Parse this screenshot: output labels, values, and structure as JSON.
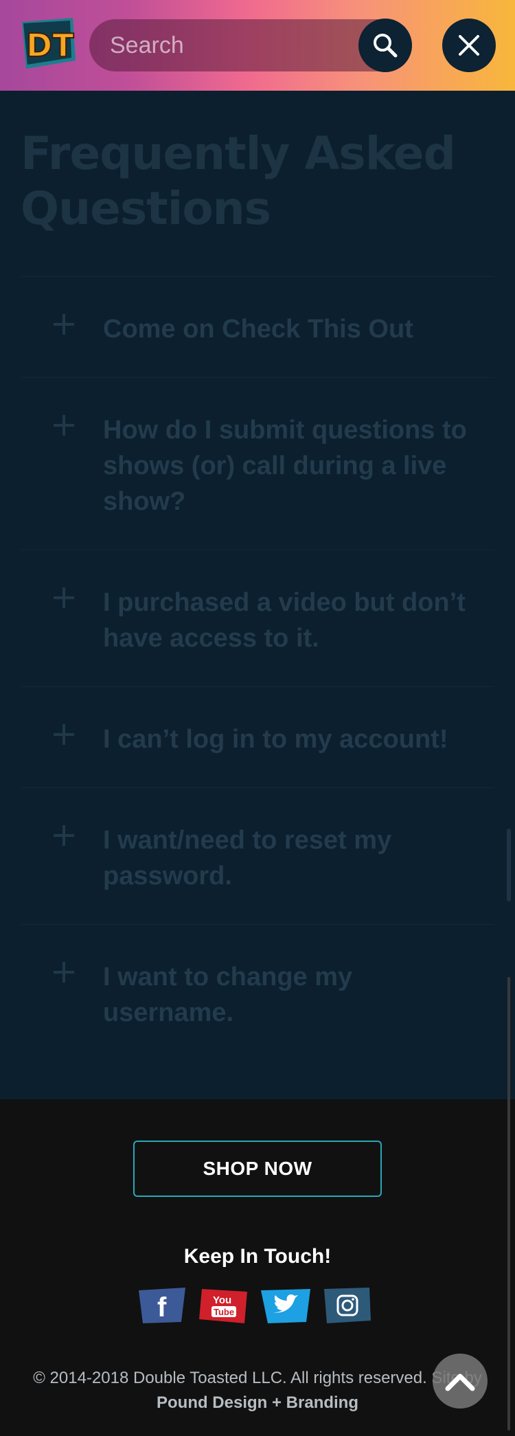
{
  "header": {
    "logo_text": "DT",
    "search": {
      "placeholder": "Search",
      "value": ""
    }
  },
  "main": {
    "title": "Frequently Asked Questions",
    "faq": [
      {
        "question": "Come on Check This Out"
      },
      {
        "question": "How do I submit questions to shows (or) call during a live show?"
      },
      {
        "question": "I purchased a video but don’t have access to it."
      },
      {
        "question": "I can’t log in to my account!"
      },
      {
        "question": "I want/need to reset my password."
      },
      {
        "question": "I want to change my username."
      }
    ]
  },
  "footer": {
    "shop_label": "SHOP NOW",
    "keep_in_touch": "Keep In Touch!",
    "social": [
      {
        "name": "facebook-icon",
        "color": "#3d5a98",
        "glyph": "f"
      },
      {
        "name": "youtube-icon",
        "color": "#d0202b",
        "glyph": "You Tube"
      },
      {
        "name": "twitter-icon",
        "color": "#1da1e2",
        "glyph": "bird"
      },
      {
        "name": "instagram-icon",
        "color": "#2e5a7a",
        "glyph": "camera"
      }
    ],
    "copyright": "© 2014-2018 Double Toasted LLC. All rights reserved. Site by",
    "credit": "Pound Design + Branding"
  },
  "colors": {
    "accent_teal": "#2aa8b8",
    "header_gradient": [
      "#a6489c",
      "#f06a8f",
      "#f8b73b"
    ],
    "page_bg": "#0c1f2e",
    "footer_bg": "#111111"
  }
}
